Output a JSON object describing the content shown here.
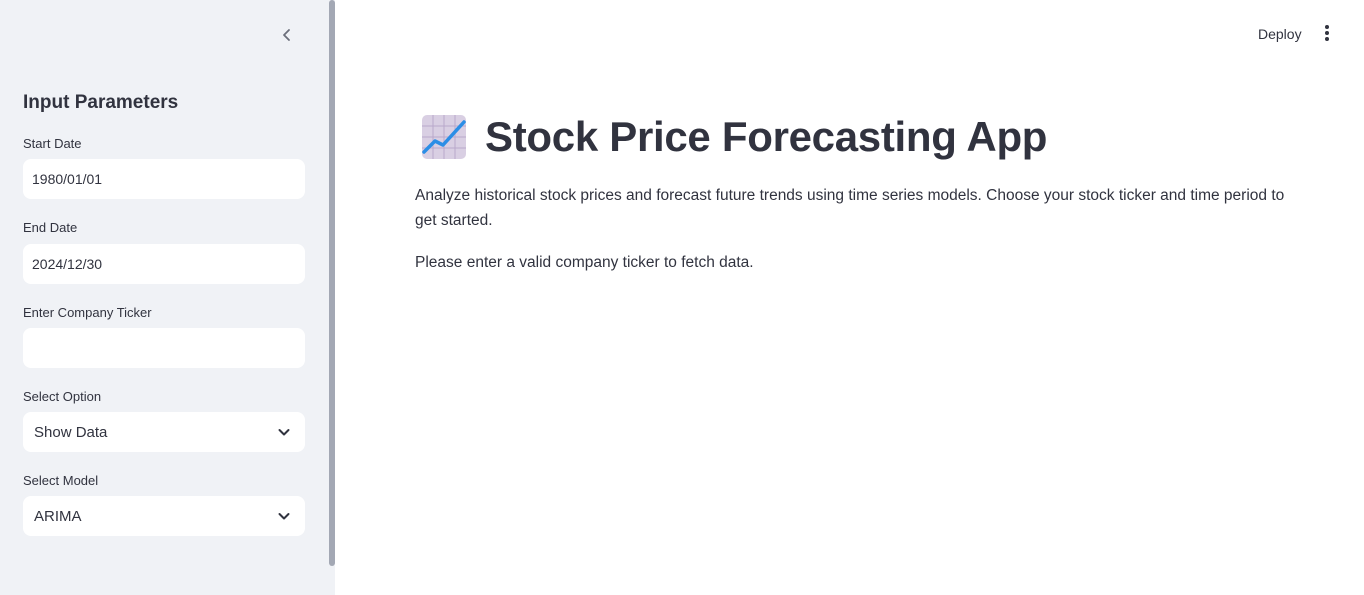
{
  "header": {
    "deploy_label": "Deploy"
  },
  "sidebar": {
    "title": "Input Parameters",
    "start_date": {
      "label": "Start Date",
      "value": "1980/01/01"
    },
    "end_date": {
      "label": "End Date",
      "value": "2024/12/30"
    },
    "ticker": {
      "label": "Enter Company Ticker",
      "value": "",
      "placeholder": ""
    },
    "option": {
      "label": "Select Option",
      "selected": "Show Data"
    },
    "model": {
      "label": "Select Model",
      "selected": "ARIMA"
    }
  },
  "main": {
    "title": "Stock Price Forecasting App",
    "intro": "Analyze historical stock prices and forecast future trends using time series models. Choose your stock ticker and time period to get started.",
    "status": "Please enter a valid company ticker to fetch data."
  },
  "icons": {
    "collapse": "chevron-left-icon",
    "menu": "vertical-dots-icon",
    "title": "chart-increasing-icon",
    "dropdown": "chevron-down-icon"
  },
  "colors": {
    "sidebar_bg": "#f0f2f6",
    "text": "#31333f",
    "chart_line": "#2b8ee6"
  }
}
